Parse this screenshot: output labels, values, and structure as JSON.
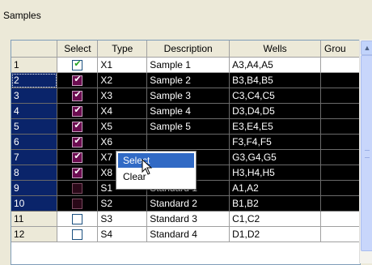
{
  "group_title": "Samples",
  "columns": [
    "",
    "Select",
    "Type",
    "Description",
    "Wells",
    "Grou"
  ],
  "rows": [
    {
      "num": "1",
      "checked": true,
      "type": "X1",
      "description": "Sample 1",
      "wells": "A3,A4,A5",
      "selected": false
    },
    {
      "num": "2",
      "checked": true,
      "type": "X2",
      "description": "Sample 2",
      "wells": "B3,B4,B5",
      "selected": true
    },
    {
      "num": "3",
      "checked": true,
      "type": "X3",
      "description": "Sample 3",
      "wells": "C3,C4,C5",
      "selected": true
    },
    {
      "num": "4",
      "checked": true,
      "type": "X4",
      "description": "Sample 4",
      "wells": "D3,D4,D5",
      "selected": true
    },
    {
      "num": "5",
      "checked": true,
      "type": "X5",
      "description": "Sample 5",
      "wells": "E3,E4,E5",
      "selected": true
    },
    {
      "num": "6",
      "checked": true,
      "type": "X6",
      "description": "",
      "wells": "F3,F4,F5",
      "selected": true
    },
    {
      "num": "7",
      "checked": true,
      "type": "X7",
      "description": "",
      "wells": "G3,G4,G5",
      "selected": true
    },
    {
      "num": "8",
      "checked": true,
      "type": "X8",
      "description": "",
      "wells": "H3,H4,H5",
      "selected": true
    },
    {
      "num": "9",
      "checked": false,
      "type": "S1",
      "description": "Standard 1",
      "wells": "A1,A2",
      "selected": true
    },
    {
      "num": "10",
      "checked": false,
      "type": "S2",
      "description": "Standard 2",
      "wells": "B1,B2",
      "selected": true
    },
    {
      "num": "11",
      "checked": false,
      "type": "S3",
      "description": "Standard 3",
      "wells": "C1,C2",
      "selected": false
    },
    {
      "num": "12",
      "checked": false,
      "type": "S4",
      "description": "Standard 4",
      "wells": "D1,D2",
      "selected": false
    }
  ],
  "context_menu": {
    "items": [
      "Select",
      "Clear"
    ],
    "highlighted": "Select"
  },
  "colors": {
    "selection": "#000000",
    "row_header_selected": "#0a246a",
    "menu_highlight": "#316ac5"
  }
}
